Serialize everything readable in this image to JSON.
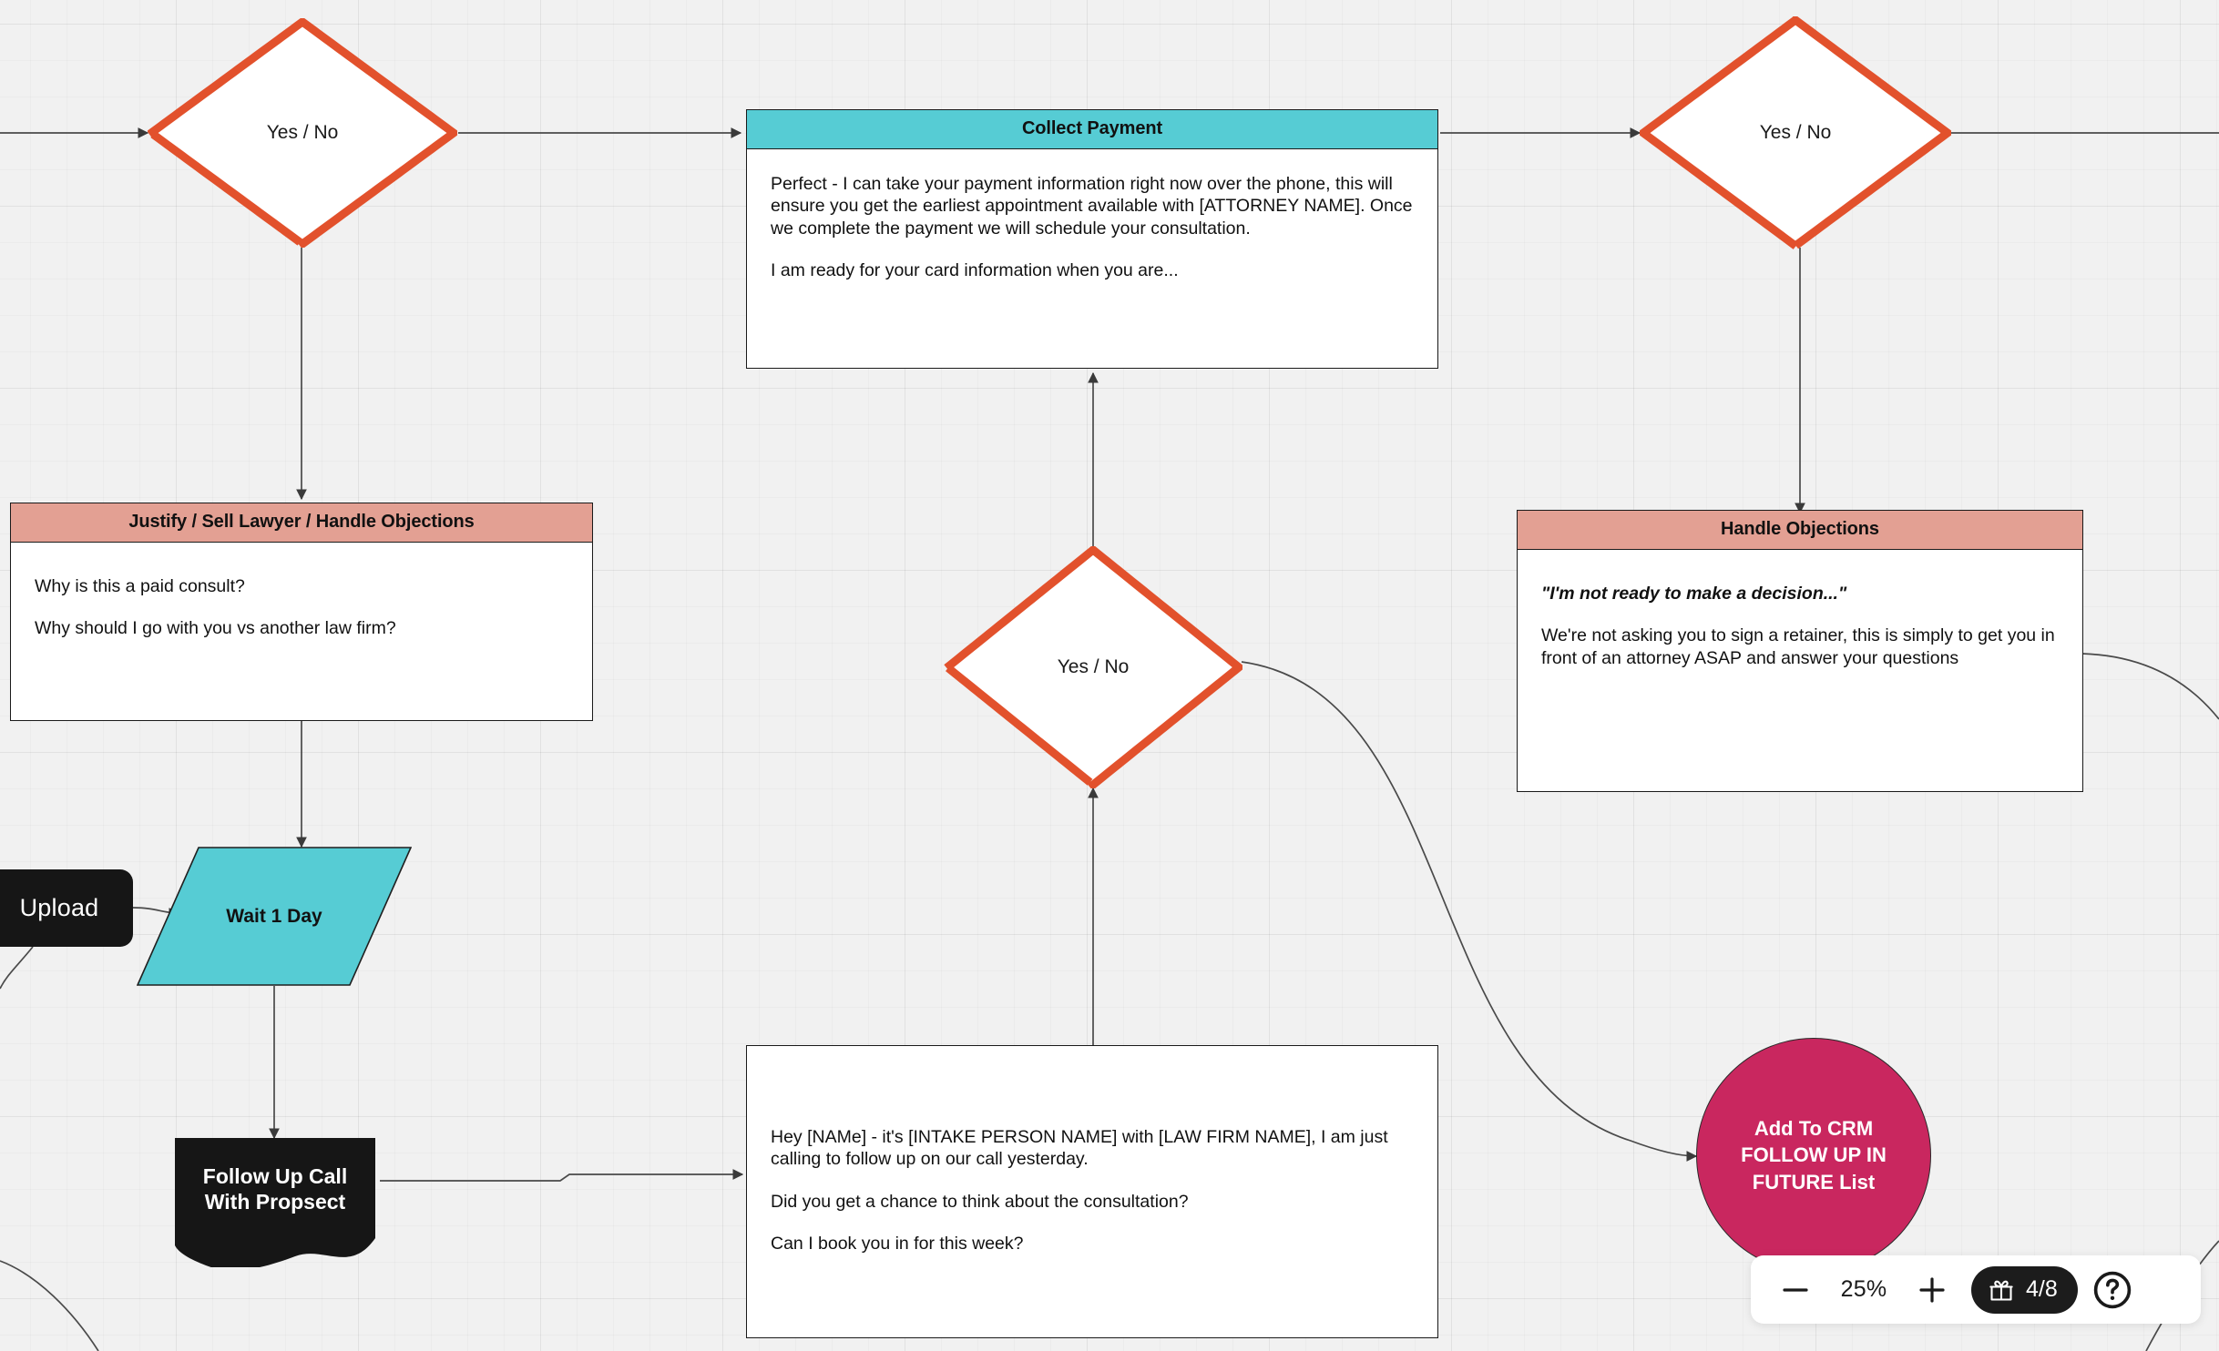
{
  "canvas": {
    "background_color": "#f1f1f1",
    "grid": "on"
  },
  "nodes": {
    "decision_top_left": {
      "label": "Yes / No",
      "shape": "diamond",
      "border_color": "#e2512c"
    },
    "decision_middle": {
      "label": "Yes / No",
      "shape": "diamond",
      "border_color": "#e2512c"
    },
    "decision_top_right": {
      "label": "Yes / No",
      "shape": "diamond",
      "border_color": "#e2512c"
    },
    "collect_payment": {
      "title": "Collect Payment",
      "header_color": "#56ccd4",
      "paragraphs": [
        "Perfect - I can take your payment information right now over the phone, this will ensure you get the earliest appointment available with [ATTORNEY NAME]. Once we complete the payment we will schedule your consultation.",
        "I am ready for your card information when you are..."
      ]
    },
    "justify_sell_lawyer": {
      "title": "Justify / Sell Lawyer / Handle Objections",
      "header_color": "#e3a093",
      "paragraphs": [
        "Why is this a paid consult?",
        "Why should I go with you vs another law firm?"
      ]
    },
    "handle_objections": {
      "title": "Handle Objections",
      "header_color": "#e3a093",
      "quote": "\"I'm not ready to make a decision...\"",
      "paragraphs": [
        "We're not asking you to sign a retainer, this is simply to get you in front of an attorney ASAP and answer your questions"
      ]
    },
    "follow_up_script": {
      "paragraphs": [
        "Hey [NAMe] - it's [INTAKE PERSON NAME] with [LAW FIRM NAME], I am just calling to follow up on our call yesterday.",
        "Did you get a chance to think about the consultation?",
        "Can I book you in for this week?"
      ]
    },
    "upload": {
      "label": "Upload",
      "shape": "rounded-rect",
      "fill": "#161616"
    },
    "wait_one_day": {
      "label": "Wait 1 Day",
      "shape": "parallelogram",
      "fill": "#56ccd4"
    },
    "follow_up_call": {
      "label_line1": "Follow Up Call",
      "label_line2": "With Propsect",
      "shape": "document",
      "fill": "#161616"
    },
    "add_to_crm": {
      "label_line1": "Add To CRM",
      "label_line2": "FOLLOW UP IN",
      "label_line3": "FUTURE List",
      "shape": "circle",
      "fill": "#c9275f"
    }
  },
  "toolbar": {
    "zoom_out_label": "−",
    "zoom_level": "25%",
    "zoom_in_label": "+",
    "credits_count": "4/8",
    "help_label": "?"
  }
}
